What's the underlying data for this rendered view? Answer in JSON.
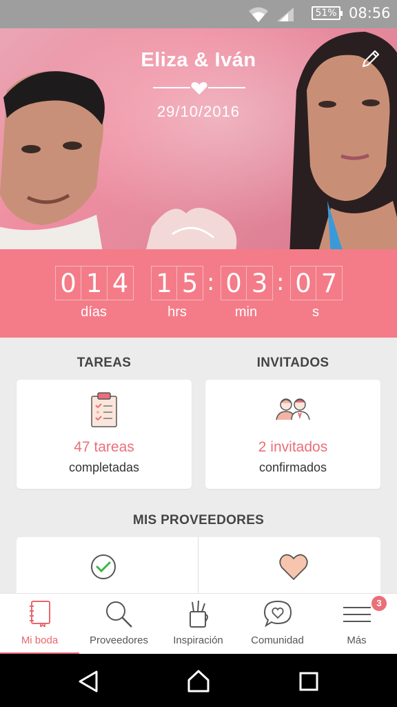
{
  "status_bar": {
    "battery": "51%",
    "time": "08:56"
  },
  "hero": {
    "names": "Eliza & Iván",
    "date": "29/10/2016"
  },
  "countdown": {
    "days": [
      "0",
      "1",
      "4"
    ],
    "hours": [
      "1",
      "5"
    ],
    "minutes": [
      "0",
      "3"
    ],
    "seconds": [
      "0",
      "7"
    ],
    "separator": ":",
    "labels": {
      "days": "días",
      "hours": "hrs",
      "minutes": "min",
      "seconds": "s"
    }
  },
  "tasks": {
    "title": "TAREAS",
    "count": "47 tareas",
    "sub": "completadas"
  },
  "guests": {
    "title": "INVITADOS",
    "count": "2 invitados",
    "sub": "confirmados"
  },
  "providers": {
    "title": "MIS PROVEEDORES"
  },
  "bottom_nav": {
    "items": [
      {
        "label": "Mi boda"
      },
      {
        "label": "Proveedores"
      },
      {
        "label": "Inspiración"
      },
      {
        "label": "Comunidad"
      },
      {
        "label": "Más"
      }
    ],
    "badge": "3"
  },
  "colors": {
    "accent": "#f37c88",
    "accent_text": "#ea6f79",
    "background": "#ececec"
  }
}
